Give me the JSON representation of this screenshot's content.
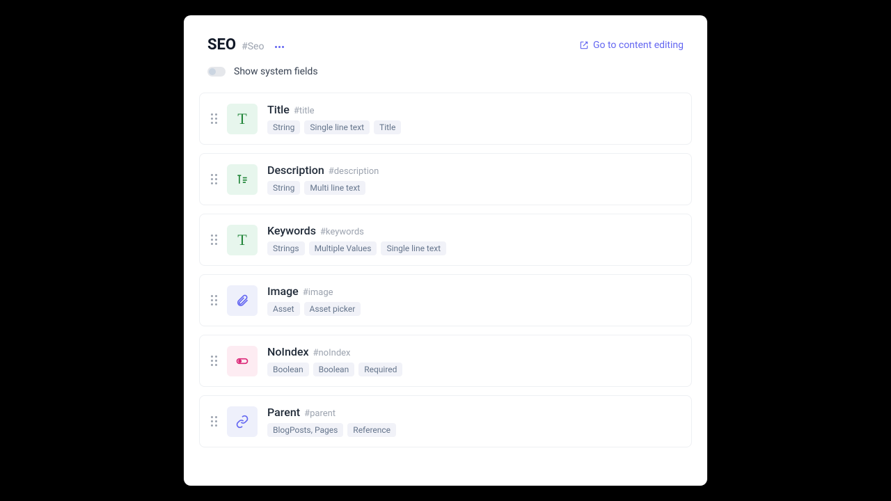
{
  "header": {
    "title": "SEO",
    "slug": "#Seo",
    "go_link": "Go to content editing"
  },
  "toggle": {
    "label": "Show system fields"
  },
  "fields": [
    {
      "name": "Title",
      "slug": "#title",
      "icon": "text",
      "icon_color": "green",
      "tags": [
        "String",
        "Single line text",
        "Title"
      ]
    },
    {
      "name": "Description",
      "slug": "#description",
      "icon": "multiline",
      "icon_color": "green",
      "tags": [
        "String",
        "Multi line text"
      ]
    },
    {
      "name": "Keywords",
      "slug": "#keywords",
      "icon": "text",
      "icon_color": "green",
      "tags": [
        "Strings",
        "Multiple Values",
        "Single line text"
      ]
    },
    {
      "name": "Image",
      "slug": "#image",
      "icon": "attachment",
      "icon_color": "purple",
      "tags": [
        "Asset",
        "Asset picker"
      ]
    },
    {
      "name": "NoIndex",
      "slug": "#noIndex",
      "icon": "toggle",
      "icon_color": "pink",
      "tags": [
        "Boolean",
        "Boolean",
        "Required"
      ]
    },
    {
      "name": "Parent",
      "slug": "#parent",
      "icon": "link",
      "icon_color": "purple",
      "tags": [
        "BlogPosts, Pages",
        "Reference"
      ]
    }
  ]
}
